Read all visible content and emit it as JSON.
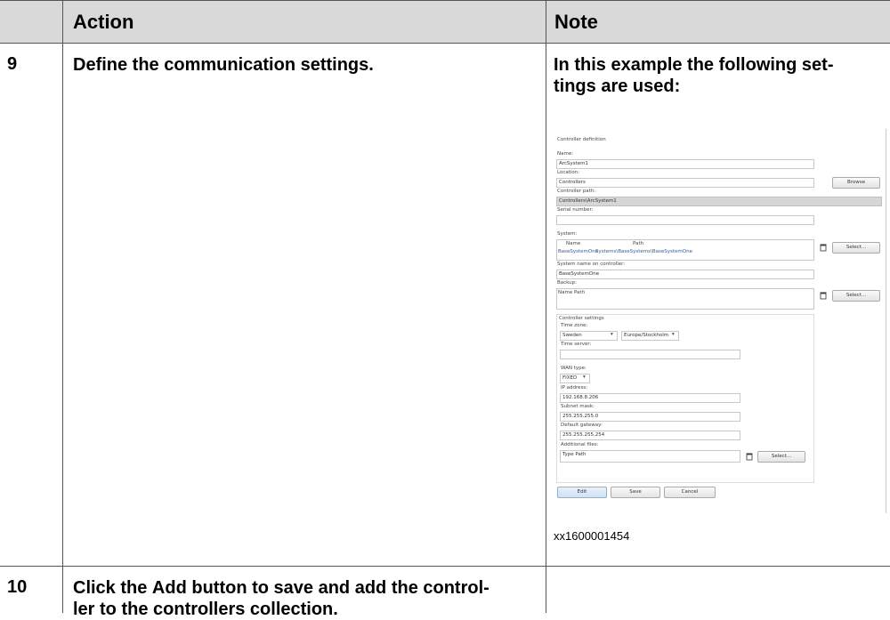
{
  "header": {
    "action": "Action",
    "note": "Note"
  },
  "rows": [
    {
      "step": "9",
      "action": "Define the communication settings.",
      "note_lines": [
        "In this example the following set-",
        "tings are used:"
      ],
      "figure_caption": "xx1600001454"
    },
    {
      "step": "10",
      "action_line1_pre": "Click the ",
      "action_line1_bold": "Add",
      "action_line1_post": " button to save and add the control-",
      "action_line2": "ler to the controllers collection."
    }
  ],
  "form": {
    "title": "Controller definition",
    "name_label": "Name:",
    "name_value": "ArcSystem1",
    "location_label": "Location:",
    "location_value": "Controllers",
    "browse_button": "Browse",
    "controller_path_label": "Controller path:",
    "controller_path_value": "Controllers\\ArcSystem1",
    "serial_label": "Serial number:",
    "serial_value": "",
    "system_label": "System:",
    "system_columns": [
      "Name",
      "Path"
    ],
    "system_row": {
      "name": "BaseSystemOne",
      "path": "Systems\\BaseSystems\\BaseSystemOne"
    },
    "select_button": "Select...",
    "system_name_label": "System name on controller:",
    "system_name_value": "BaseSystemOne",
    "backup_label": "Backup:",
    "backup_header": "Name  Path",
    "controller_settings_label": "Controller settings",
    "time_zone_label": "Time zone:",
    "time_zone_country": "Sweden",
    "time_zone_region": "Europe/Stockholm",
    "time_server_label": "Time server:",
    "wan_type_label": "WAN type:",
    "wan_type_value": "FIXED",
    "ip_label": "IP address:",
    "ip_value": "192.168.8.206",
    "subnet_label": "Subnet mask:",
    "subnet_value": "255.255.255.0",
    "gateway_label": "Default gateway:",
    "gateway_value": "255.255.255.254",
    "additional_label": "Additional files:",
    "additional_header": "Type  Path",
    "edit_button": "Edit",
    "save_button": "Save",
    "cancel_button": "Cancel"
  }
}
